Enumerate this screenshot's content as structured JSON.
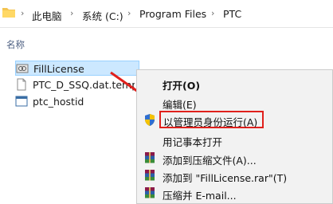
{
  "address_bar": {
    "crumbs": [
      "此电脑",
      "系统 (C:)",
      "Program Files",
      "PTC"
    ]
  },
  "column_header": "名称",
  "files": [
    {
      "name": "FillLicense",
      "icon": "app-icon",
      "selected": true
    },
    {
      "name": "PTC_D_SSQ.dat.template",
      "icon": "document-icon",
      "selected": false
    },
    {
      "name": "ptc_hostid",
      "icon": "app-window-icon",
      "selected": false
    }
  ],
  "context_menu": {
    "items": [
      {
        "label": "打开(O)",
        "icon": "",
        "bold": true
      },
      {
        "label": "编辑(E)",
        "icon": ""
      },
      {
        "label": "以管理员身份运行(A)",
        "icon": "uac-shield-icon",
        "highlighted": true
      },
      {
        "label": "用记事本打开",
        "icon": ""
      },
      {
        "label": "添加到压缩文件(A)...",
        "icon": "winrar-icon"
      },
      {
        "label": "添加到 \"FillLicense.rar\"(T)",
        "icon": "winrar-icon"
      },
      {
        "label": "压缩并 E-mail...",
        "icon": "winrar-icon"
      }
    ]
  },
  "colors": {
    "highlight_border": "#e0201c",
    "selection_bg": "#cce8ff",
    "menu_bg": "#f2f2f2"
  }
}
